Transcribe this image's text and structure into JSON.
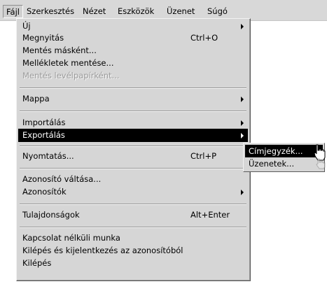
{
  "menubar": {
    "items": [
      {
        "label": "Fájl"
      },
      {
        "label": "Szerkesztés"
      },
      {
        "label": "Nézet"
      },
      {
        "label": "Eszközök"
      },
      {
        "label": "Üzenet"
      },
      {
        "label": "Súgó"
      }
    ]
  },
  "file_menu": {
    "items": [
      {
        "label": "Új"
      },
      {
        "label": "Megnyitás",
        "shortcut": "Ctrl+O"
      },
      {
        "label": "Mentés másként..."
      },
      {
        "label": "Mellékletek mentése..."
      },
      {
        "label": "Mentés levélpapírként..."
      },
      {
        "label": "Mappa"
      },
      {
        "label": "Importálás"
      },
      {
        "label": "Exportálás"
      },
      {
        "label": "Nyomtatás...",
        "shortcut": "Ctrl+P"
      },
      {
        "label": "Azonosító váltása..."
      },
      {
        "label": "Azonosítók"
      },
      {
        "label": "Tulajdonságok",
        "shortcut": "Alt+Enter"
      },
      {
        "label": "Kapcsolat nélküli munka"
      },
      {
        "label": "Kilépés és kijelentkezés az azonosítóból"
      },
      {
        "label": "Kilépés"
      }
    ]
  },
  "export_submenu": {
    "items": [
      {
        "label": "Címjegyzék..."
      },
      {
        "label": "Üzenetek..."
      }
    ]
  },
  "colors": {
    "menu_bg": "#d6d6d6",
    "highlight_bg": "#000000",
    "highlight_text": "#ffffff",
    "disabled_text": "#9c9c9c"
  }
}
